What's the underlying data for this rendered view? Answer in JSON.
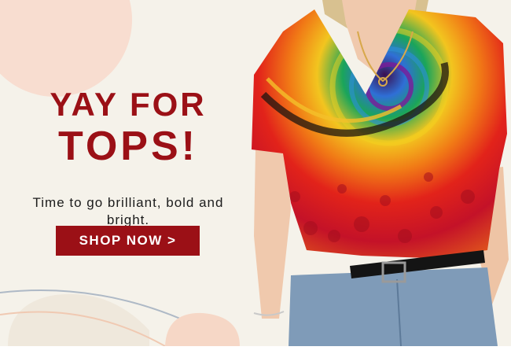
{
  "banner": {
    "headline_line1": "YAY FOR",
    "headline_line2": "TOPS!",
    "tagline": "Time to go brilliant, bold and bright.",
    "cta_label": "SHOP NOW >"
  },
  "colors": {
    "brand_red": "#9b1016",
    "background": "#f5f2ea",
    "decor_peach": "#f8ddd0",
    "denim": "#7f9bb8"
  },
  "image": {
    "subject": "model-wearing-psychedelic-spiral-print-v-neck-top"
  }
}
